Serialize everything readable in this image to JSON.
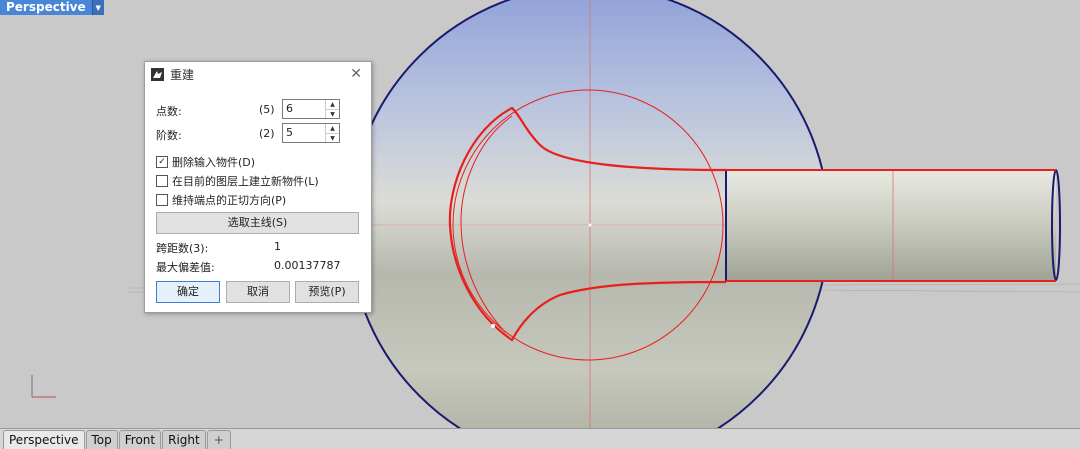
{
  "viewport": {
    "name": "Perspective"
  },
  "dialog": {
    "title": "重建",
    "close_glyph": "✕",
    "point_count": {
      "label": "点数:",
      "original": "(5)",
      "value": "6"
    },
    "degree": {
      "label": "阶数:",
      "original": "(2)",
      "value": "5"
    },
    "options": [
      {
        "label": "删除输入物件(D)",
        "checked": true
      },
      {
        "label": "在目前的图层上建立新物件(L)",
        "checked": false
      },
      {
        "label": "维持端点的正切方向(P)",
        "checked": false
      }
    ],
    "select_button": "选取主线(S)",
    "span_count": {
      "label": "跨距数(3):",
      "value": "1"
    },
    "max_deviation": {
      "label": "最大偏差值:",
      "value": "0.00137787"
    },
    "buttons": {
      "ok": "确定",
      "cancel": "取消",
      "preview": "预览(P)"
    }
  },
  "tabs": [
    "Perspective",
    "Top",
    "Front",
    "Right",
    "+"
  ],
  "colors": {
    "viewport_bg": "#c9c9c9",
    "label_bg": "#4a86d6",
    "curve_red": "#e8201c",
    "sphere_edge": "#1a1a6e"
  }
}
